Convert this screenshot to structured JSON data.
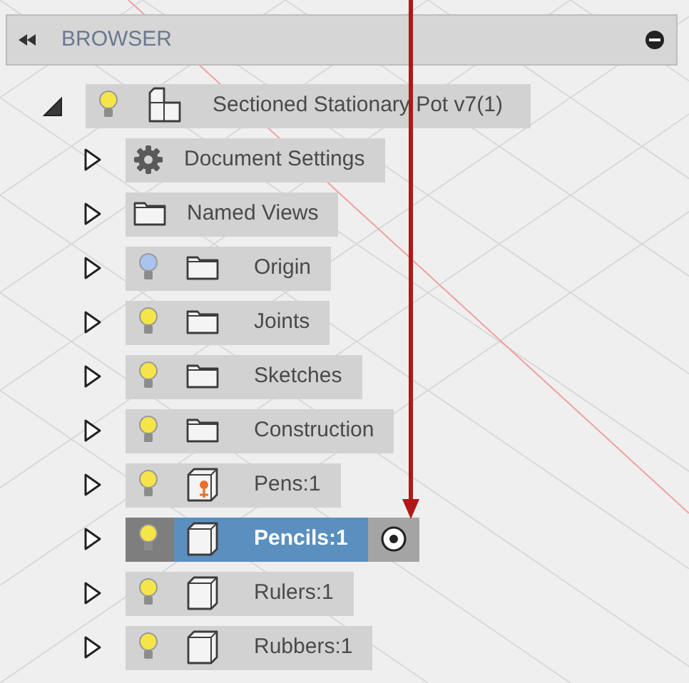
{
  "panel": {
    "title": "BROWSER"
  },
  "root": {
    "label": "Sectioned Stationary Pot v7(1)",
    "expanded": true,
    "visible": true,
    "kind": "component",
    "children": [
      {
        "label": "Document Settings",
        "kind": "settings",
        "expanded": false,
        "selected": false,
        "active": false
      },
      {
        "label": "Named Views",
        "kind": "folder",
        "expanded": false,
        "selected": false,
        "active": false
      },
      {
        "label": "Origin",
        "kind": "folder",
        "visible": false,
        "expanded": false,
        "selected": false,
        "active": false
      },
      {
        "label": "Joints",
        "kind": "folder",
        "visible": true,
        "expanded": false,
        "selected": false,
        "active": false
      },
      {
        "label": "Sketches",
        "kind": "folder",
        "visible": true,
        "expanded": false,
        "selected": false,
        "active": false
      },
      {
        "label": "Construction",
        "kind": "folder",
        "visible": true,
        "expanded": false,
        "selected": false,
        "active": false
      },
      {
        "label": "Pens:1",
        "kind": "pinned",
        "visible": true,
        "expanded": false,
        "selected": false,
        "active": false
      },
      {
        "label": "Pencils:1",
        "kind": "body",
        "visible": true,
        "expanded": false,
        "selected": true,
        "active": true
      },
      {
        "label": "Rulers:1",
        "kind": "body",
        "visible": true,
        "expanded": false,
        "selected": false,
        "active": false
      },
      {
        "label": "Rubbers:1",
        "kind": "body",
        "visible": true,
        "expanded": false,
        "selected": false,
        "active": false
      }
    ]
  }
}
